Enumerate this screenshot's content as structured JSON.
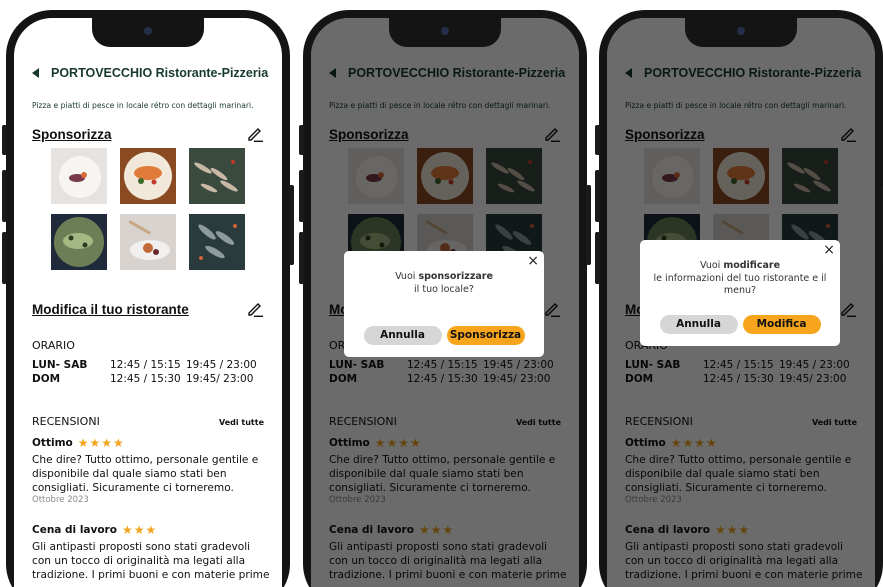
{
  "restaurant": {
    "title": "PORTOVECCHIO Ristorante-Pizzeria",
    "description": "Pizza e piatti di pesce in locale rétro con dettagli marinari."
  },
  "sponsor_section": {
    "label": "Sponsorizza",
    "edit_icon": "pencil-icon"
  },
  "photos": [
    "plate-dish-photo",
    "salmon-dish-photo",
    "fish-rack-photo",
    "green-seafood-photo",
    "fork-food-photo",
    "whole-fish-photo"
  ],
  "edit_section": {
    "label": "Modifica il tuo ristorante",
    "edit_icon": "pencil-icon"
  },
  "hours": {
    "label": "ORARIO",
    "rows": [
      {
        "day": "LUN- SAB",
        "lunch": "12:45 / 15:15",
        "dinner": "19:45 / 23:00"
      },
      {
        "day": "DOM",
        "lunch": "12:45 / 15:30",
        "dinner": "19:45/ 23:00"
      }
    ]
  },
  "reviews": {
    "label": "RECENSIONI",
    "see_all": "Vedi tutte",
    "items": [
      {
        "title": "Ottimo",
        "stars": 4,
        "stars_glyphs": "★★★★",
        "text": "Che dire? Tutto ottimo, personale gentile e disponibile dal quale siamo stati ben consigliati. Sicuramente ci torneremo.",
        "date": "Ottobre 2023"
      },
      {
        "title": "Cena di lavoro",
        "stars": 3,
        "stars_glyphs": "★★★",
        "text": "Gli antipasti proposti sono stati gradevoli con un tocco di originalità ma legati alla tradizione. I primi buoni e con materie prime",
        "date": ""
      }
    ]
  },
  "dialog_sponsor": {
    "pre": "Vuoi ",
    "bold": "sponsorizzare",
    "post": "il tuo locale?",
    "cancel": "Annulla",
    "confirm": "Sponsorizza",
    "close": "×"
  },
  "dialog_edit": {
    "pre": "Vuoi ",
    "bold": "modificare",
    "post": "le informazioni del tuo ristorante e il menu?",
    "cancel": "Annulla",
    "confirm": "Modifica",
    "close": "×"
  },
  "colors": {
    "brand_green": "#173a2a",
    "accent_orange": "#f7a51d",
    "star": "#f4a41e"
  }
}
